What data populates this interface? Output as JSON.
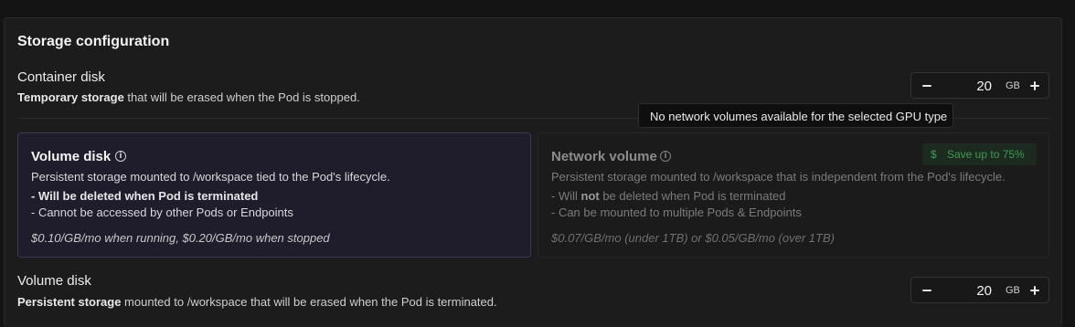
{
  "section_title": "Storage configuration",
  "container_disk": {
    "title": "Container disk",
    "desc_bold": "Temporary storage",
    "desc_rest": " that will be erased when the Pod is stopped.",
    "value": "20",
    "unit": "GB"
  },
  "tooltip": "No network volumes available for the selected GPU type",
  "volume_card": {
    "title": "Volume disk",
    "desc": "Persistent storage mounted to /workspace tied to the Pod's lifecycle.",
    "line1": "- Will be deleted when Pod is terminated",
    "line2": "- Cannot be accessed by other Pods or Endpoints",
    "price": "$0.10/GB/mo when running, $0.20/GB/mo when stopped"
  },
  "network_card": {
    "title": "Network volume",
    "badge_icon": "$",
    "badge": "Save up to 75%",
    "desc": "Persistent storage mounted to /workspace that is independent from the Pod's lifecycle.",
    "line1_pre": "- Will ",
    "line1_bold": "not",
    "line1_post": " be deleted when Pod is terminated",
    "line2": "- Can be mounted to multiple Pods & Endpoints",
    "price": "$0.07/GB/mo (under 1TB) or $0.05/GB/mo (over 1TB)"
  },
  "volume_disk": {
    "title": "Volume disk",
    "desc_bold": "Persistent storage",
    "desc_rest": " mounted to /workspace that will be erased when the Pod is terminated.",
    "value": "20",
    "unit": "GB"
  },
  "icons": {
    "info": "info-icon",
    "minus": "minus-icon",
    "plus": "plus-icon",
    "dollar": "dollar-icon"
  },
  "colors": {
    "selected_card_bg": "#1f1c2c",
    "selected_card_border": "#3b3557",
    "savings_green": "#3e9a55"
  }
}
